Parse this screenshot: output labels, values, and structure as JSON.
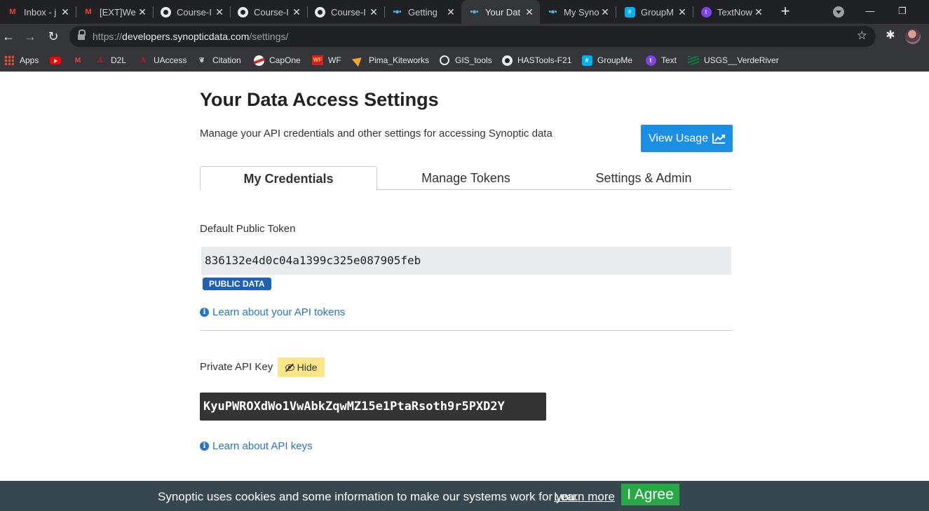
{
  "browser": {
    "tabs": [
      {
        "title": "Inbox - j",
        "icon": "gmail-icon"
      },
      {
        "title": "[EXT]We",
        "icon": "gmail-icon"
      },
      {
        "title": "Course-I",
        "icon": "github-icon"
      },
      {
        "title": "Course-I",
        "icon": "github-icon"
      },
      {
        "title": "Course-I",
        "icon": "github-icon"
      },
      {
        "title": "Getting",
        "icon": "synoptic-icon"
      },
      {
        "title": "Your Dat",
        "icon": "synoptic-icon",
        "active": true
      },
      {
        "title": "My Syno",
        "icon": "synoptic-icon"
      },
      {
        "title": "GroupM",
        "icon": "groupme-icon"
      },
      {
        "title": "TextNow",
        "icon": "textnow-icon"
      }
    ],
    "close_glyph": "✕",
    "new_tab_glyph": "+",
    "window": {
      "minimize": "—",
      "maximize": "❐",
      "close": "✕"
    },
    "nav": {
      "back": "←",
      "forward": "→",
      "reload": "↻"
    },
    "url": {
      "scheme": "https://",
      "host": "developers.synopticdata.com",
      "path": "/settings/"
    },
    "bookmark_star": "☆",
    "extensions_glyph": "✱",
    "bookmarks": [
      {
        "label": "Apps",
        "icon": "apps-grid-icon"
      },
      {
        "label": "",
        "icon": "youtube-icon"
      },
      {
        "label": "",
        "icon": "gmail-icon"
      },
      {
        "label": "D2L",
        "icon": "arizona-a-icon"
      },
      {
        "label": "UAccess",
        "icon": "arizona-a-icon"
      },
      {
        "label": "Citation",
        "icon": "citation-icon"
      },
      {
        "label": "CapOne",
        "icon": "capital-one-icon"
      },
      {
        "label": "WF",
        "icon": "wells-fargo-icon"
      },
      {
        "label": "Pima_Kiteworks",
        "icon": "kiteworks-icon"
      },
      {
        "label": "GIS_tools",
        "icon": "globe-icon"
      },
      {
        "label": "HASTools-F21",
        "icon": "github-icon"
      },
      {
        "label": "GroupMe",
        "icon": "groupme-icon"
      },
      {
        "label": "Text",
        "icon": "textnow-icon"
      },
      {
        "label": "USGS__VerdeRiver",
        "icon": "usgs-icon"
      }
    ]
  },
  "page": {
    "title": "Your Data Access Settings",
    "description": "Manage your API credentials and other settings for accessing Synoptic data",
    "view_usage_label": "View Usage",
    "tabs": [
      {
        "label": "My Credentials",
        "active": true
      },
      {
        "label": "Manage Tokens"
      },
      {
        "label": "Settings & Admin"
      }
    ],
    "public_token": {
      "label": "Default Public Token",
      "value": "836132e4d0c04a1399c325e087905feb",
      "badge": "PUBLIC DATA",
      "help_link": "Learn about your API tokens"
    },
    "private_key": {
      "label": "Private API Key",
      "hide_label": "Hide",
      "value": "KyuPWROXdWo1VwAbkZqwMZ15e1PtaRsoth9r5PXD2Y",
      "help_link": "Learn about API keys"
    },
    "info_glyph": "i"
  },
  "cookie_bar": {
    "text": "Synoptic uses cookies and some information to make our systems work for you.",
    "learn_more": "Learn more",
    "agree": "I Agree"
  },
  "colors": {
    "primary_button": "#1a8fe3",
    "badge": "#1e62b5",
    "hide_button": "#fde68a",
    "agree_button": "#28a745",
    "cookie_bar": "#37474f",
    "link": "#2574c8"
  }
}
